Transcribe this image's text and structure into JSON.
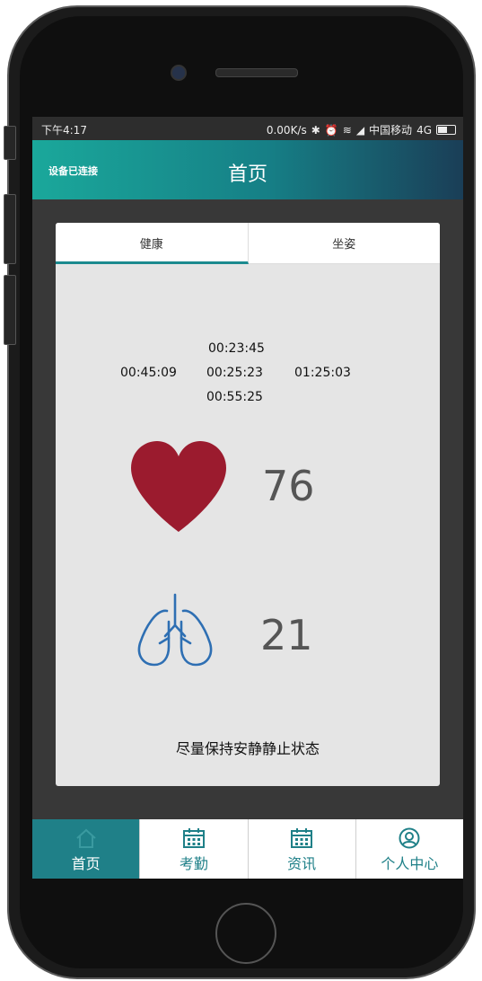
{
  "status_bar": {
    "time": "下午4:17",
    "net_speed": "0.00K/s",
    "carrier": "中国移动",
    "network": "4G",
    "icons": [
      "bluetooth-icon",
      "alarm-icon",
      "wifi-icon",
      "signal-icon",
      "battery-icon"
    ]
  },
  "header": {
    "connection_status": "设备已连接",
    "title": "首页"
  },
  "tabs": [
    {
      "label": "健康",
      "active": true
    },
    {
      "label": "坐姿",
      "active": false
    }
  ],
  "timers": {
    "top": "00:23:45",
    "left": "00:45:09",
    "center": "00:25:23",
    "right": "01:25:03",
    "bottom": "00:55:25"
  },
  "vitals": {
    "heart_rate": "76",
    "respiration": "21"
  },
  "hint": "尽量保持安静静止状态",
  "bottom_nav": [
    {
      "label": "首页",
      "icon": "home-icon",
      "active": true
    },
    {
      "label": "考勤",
      "icon": "calendar-icon",
      "active": false
    },
    {
      "label": "资讯",
      "icon": "calendar-icon",
      "active": false
    },
    {
      "label": "个人中心",
      "icon": "user-icon",
      "active": false
    }
  ],
  "colors": {
    "accent": "#1f8088",
    "heart": "#9b1b2e",
    "lung": "#2e6fb3"
  }
}
